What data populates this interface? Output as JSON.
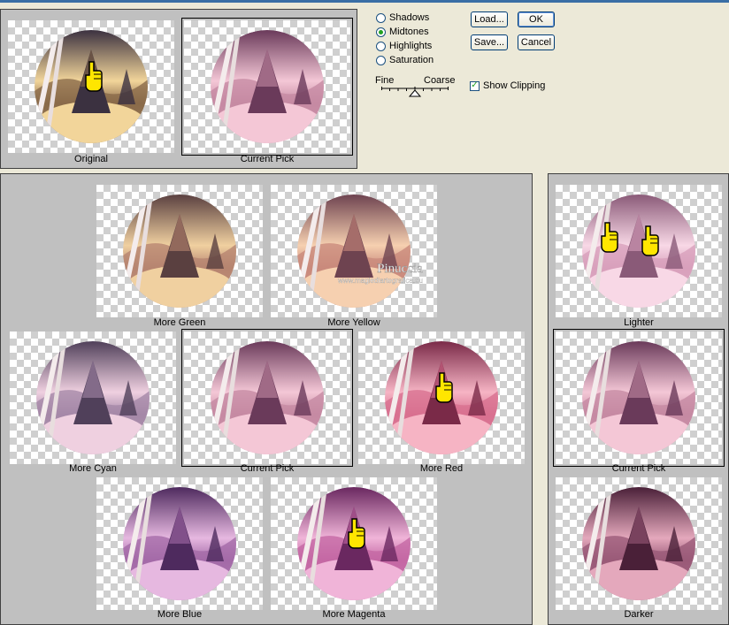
{
  "dialog": {
    "range_options": [
      {
        "label": "Shadows",
        "selected": false
      },
      {
        "label": "Midtones",
        "selected": true
      },
      {
        "label": "Highlights",
        "selected": false
      },
      {
        "label": "Saturation",
        "selected": false
      }
    ],
    "buttons": {
      "load": "Load...",
      "ok": "OK",
      "save": "Save...",
      "cancel": "Cancel"
    },
    "slider": {
      "left_label": "Fine",
      "right_label": "Coarse"
    },
    "show_clipping": {
      "label": "Show Clipping",
      "checked": true
    }
  },
  "preview": {
    "original": "Original",
    "current": "Current Pick"
  },
  "color_variations": {
    "more_green": "More Green",
    "more_yellow": "More Yellow",
    "more_cyan": "More Cyan",
    "current": "Current Pick",
    "more_red": "More Red",
    "more_blue": "More Blue",
    "more_magenta": "More Magenta"
  },
  "brightness": {
    "lighter": "Lighter",
    "current": "Current Pick",
    "darker": "Darker"
  },
  "watermark": {
    "line1": "Pinuccia",
    "line2": "www.magiediartegrafica.eu"
  },
  "colors": {
    "original": [
      "#f2d59a",
      "#8a6a4a",
      "#3b3140"
    ],
    "current": [
      "#f4c7d6",
      "#c58aa3",
      "#6a3a5a"
    ],
    "green": [
      "#f0d0a0",
      "#b78570",
      "#5a4040"
    ],
    "yellow": [
      "#f6d0b0",
      "#c98a7c",
      "#6e4350"
    ],
    "cyan": [
      "#efd0e0",
      "#a588a8",
      "#50405a"
    ],
    "red": [
      "#f6b4c4",
      "#d87090",
      "#7a2a48"
    ],
    "blue": [
      "#e6b8e0",
      "#a46aa8",
      "#4e2a5e"
    ],
    "magenta": [
      "#f0b4d8",
      "#c468a4",
      "#6a2860"
    ],
    "lighter": [
      "#f8d8e6",
      "#d8a0bc",
      "#8a5a78"
    ],
    "darker": [
      "#e4a8bc",
      "#9a5a78",
      "#4a2038"
    ]
  }
}
